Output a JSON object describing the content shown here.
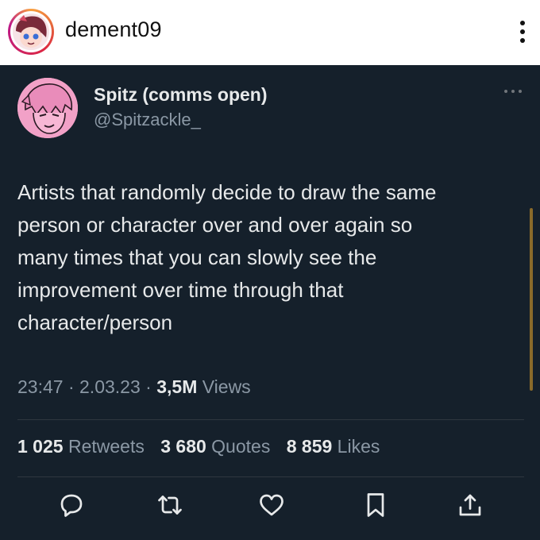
{
  "instagram": {
    "username": "dement09",
    "more_icon": "vertical-dots-icon"
  },
  "tweet": {
    "display_name": "Spitz (comms open)",
    "handle": "@Spitzackle_",
    "text": "Artists that randomly decide to draw the same\nperson or character over and over again so\nmany times that you can slowly see the\nimprovement over time through that\ncharacter/person",
    "time": "23:47",
    "date": "2.03.23",
    "views_count": "3,5M",
    "views_label": "Views",
    "separator": "·",
    "stats": {
      "retweets_count": "1 025",
      "retweets_label": "Retweets",
      "quotes_count": "3 680",
      "quotes_label": "Quotes",
      "likes_count": "8 859",
      "likes_label": "Likes"
    },
    "actions": [
      "reply-icon",
      "retweet-icon",
      "like-icon",
      "bookmark-icon",
      "share-icon"
    ]
  },
  "colors": {
    "tweet_background": "#15202b",
    "primary_text": "#e7e9ea",
    "secondary_text": "#8b98a5",
    "avatar_pink": "#f2a1c7"
  }
}
